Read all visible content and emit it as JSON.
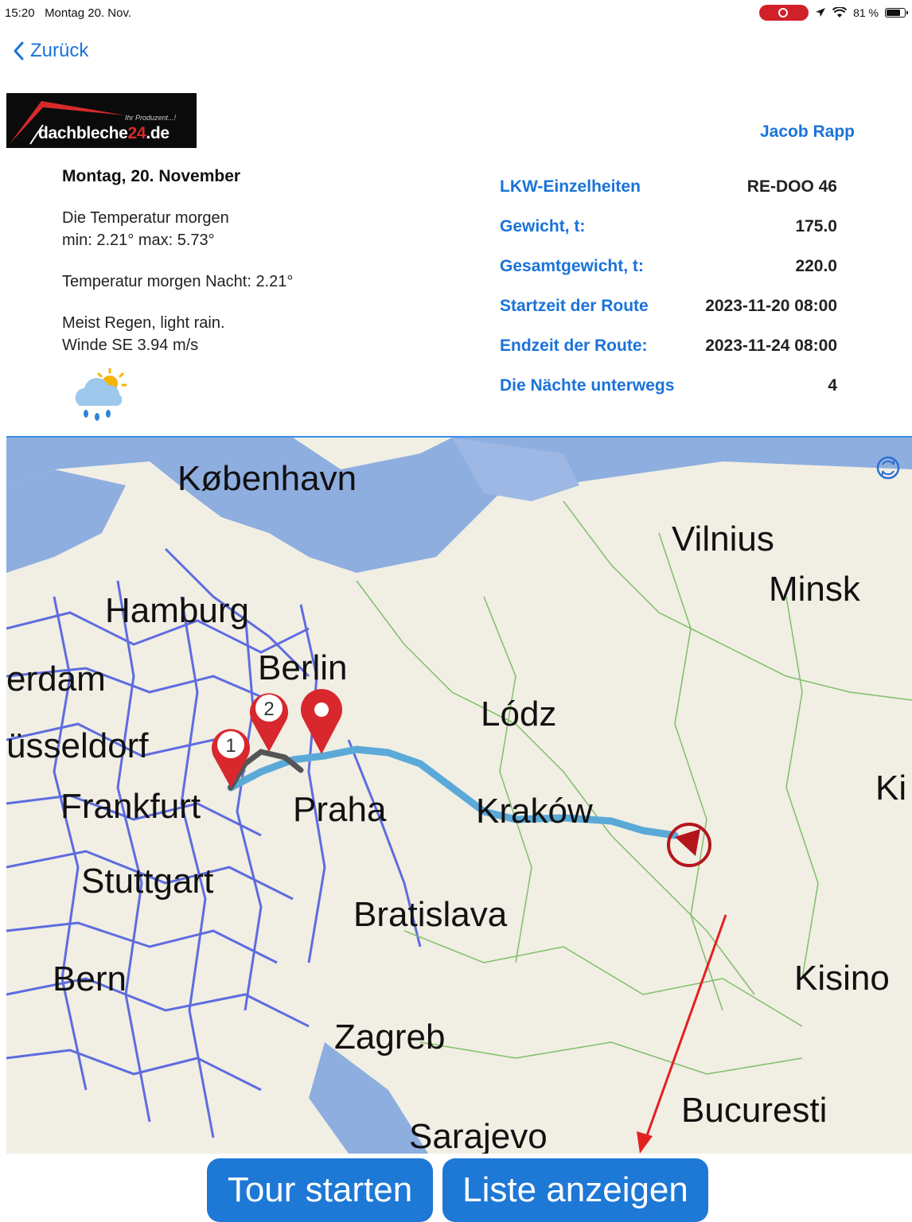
{
  "status_bar": {
    "time": "15:20",
    "date": "Montag 20. Nov.",
    "battery": "81 %",
    "battery_level": 0.81
  },
  "nav": {
    "back_label": "Zurück"
  },
  "logo": {
    "text_part1": "dachbleche",
    "text_accent": "24",
    "text_part2": ".de",
    "tagline": "Ihr Produzent...!"
  },
  "user": {
    "name": "Jacob Rapp"
  },
  "weather": {
    "date": "Montag, 20. November",
    "temp_tomorrow_line1": "Die Temperatur morgen",
    "temp_tomorrow_line2": "min: 2.21° max: 5.73°",
    "temp_night": "Temperatur morgen Nacht: 2.21°",
    "condition_line1": "Meist Regen, light rain.",
    "condition_line2": "Winde SE 3.94 m/s",
    "icon": "rain-cloud-sun-icon"
  },
  "truck": {
    "rows": [
      {
        "label": "LKW-Einzelheiten",
        "value": "RE-DOO 46"
      },
      {
        "label": "Gewicht, t:",
        "value": "175.0"
      },
      {
        "label": "Gesamtgewicht, t:",
        "value": "220.0"
      },
      {
        "label": "Startzeit der Route",
        "value": "2023-11-20 08:00"
      },
      {
        "label": "Endzeit der Route:",
        "value": "2023-11-24 08:00"
      },
      {
        "label": "Die Nächte unterwegs",
        "value": "4"
      }
    ]
  },
  "map": {
    "cities": [
      "København",
      "Vilnius",
      "Minsk",
      "Hamburg",
      "Berlin",
      "erdam",
      "Lódz",
      "üsseldorf",
      "Frankfurt",
      "Praha",
      "Kraków",
      "Ki",
      "Stuttgart",
      "Bratislava",
      "Bern",
      "Kisino",
      "Zagreb",
      "Bucuresti",
      "Sarajevo"
    ],
    "markers": [
      "1",
      "2"
    ],
    "colors": {
      "water": "#8eaee0",
      "road": "#4f5fe0",
      "route": "#5aa9d8",
      "marker": "#d9272e"
    }
  },
  "actions": {
    "start_tour": "Tour starten",
    "show_list": "Liste anzeigen"
  }
}
